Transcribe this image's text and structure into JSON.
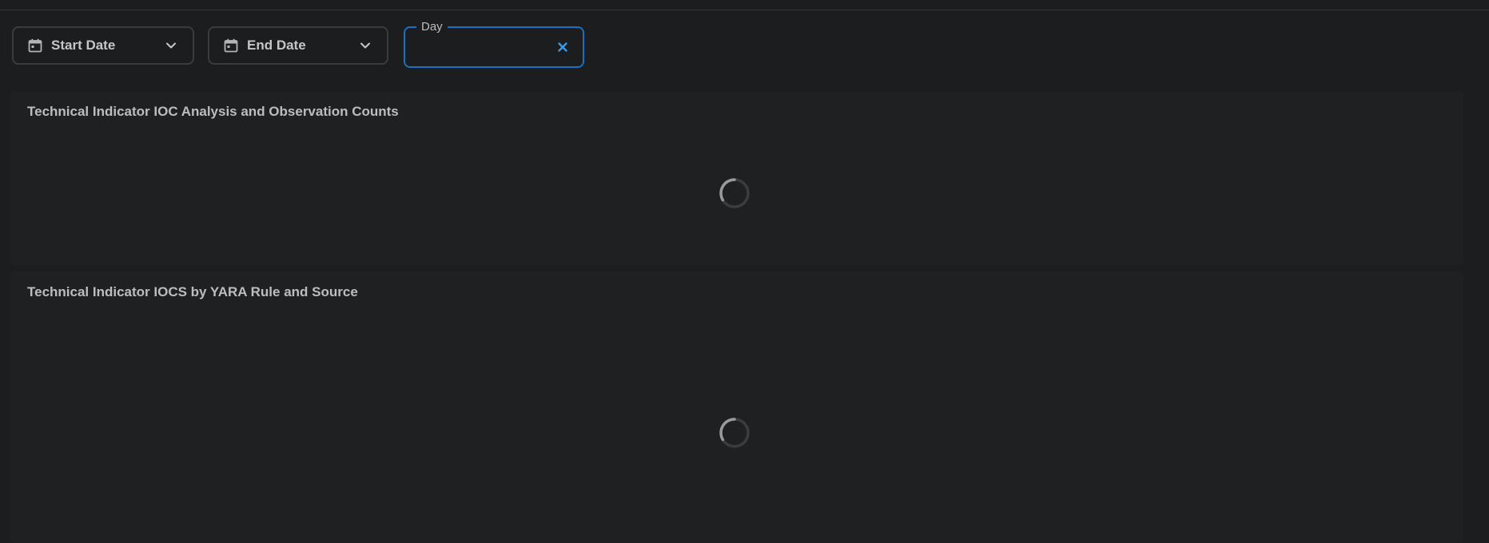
{
  "filters": {
    "start_date": {
      "label": "Start Date",
      "icon": "calendar-icon"
    },
    "end_date": {
      "label": "End Date",
      "icon": "calendar-icon"
    },
    "day": {
      "legend": "Day",
      "value": "",
      "clear_icon": "close-icon"
    }
  },
  "panels": [
    {
      "title": "Technical Indicator IOC Analysis and Observation Counts",
      "state": "loading"
    },
    {
      "title": "Technical Indicator IOCS by YARA Rule and Source",
      "state": "loading"
    }
  ],
  "colors": {
    "background": "#1b1d1e",
    "panel": "#1e2021",
    "border": "#393c3f",
    "focus_border": "#1b6fc4",
    "accent": "#3c9be8"
  }
}
